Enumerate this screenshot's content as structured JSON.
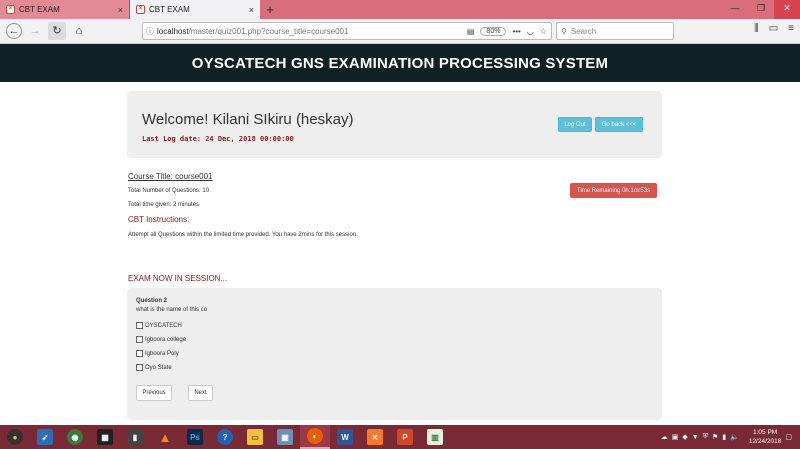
{
  "browser": {
    "tabs": [
      {
        "label": "CBT EXAM",
        "active": false
      },
      {
        "label": "CBT EXAM",
        "active": true
      }
    ],
    "url_host": "localhost",
    "url_rest": "/master/quiz001.php?course_title=course001",
    "zoom": "80%",
    "search_placeholder": "Search"
  },
  "header": {
    "title": "OYSCATECH GNS EXAMINATION PROCESSING SYSTEM"
  },
  "welcome": {
    "title": "Welcome! Kilani SIkiru (heskay)",
    "last_log": "Last Log date: 24 Dec, 2018 00:00:00",
    "logout_label": "Log Out",
    "goback_label": "Go back <<<"
  },
  "course": {
    "title": "Course Title: course001",
    "total_questions": "Total Number of Questions: 10",
    "total_time": "Total time given: 2 minutes",
    "instructions_heading": "CBT Instructions:",
    "instructions_text": "Attempt all Questions within the limited time provided. You have 2mins for this session.",
    "time_remaining": "Time Remaining 0h:1m:53s"
  },
  "exam": {
    "session_label": "EXAM NOW IN SESSION...",
    "question_number": "Question 2",
    "question_text": "what is the name of this co",
    "options": [
      "OYSCATECH",
      "Igboora college",
      "Igboora Poly",
      "Oyo State"
    ],
    "previous_label": "Previous",
    "next_label": "Next"
  },
  "taskbar": {
    "time": "1:05 PM",
    "date": "12/24/2018"
  },
  "colors": {
    "tabbar": "#d96e7b",
    "header_band": "#0f2122",
    "accent_red": "#8b1a1a",
    "info_button": "#5bc0de",
    "danger_button": "#d9534f",
    "taskbar": "#7a2a35"
  }
}
